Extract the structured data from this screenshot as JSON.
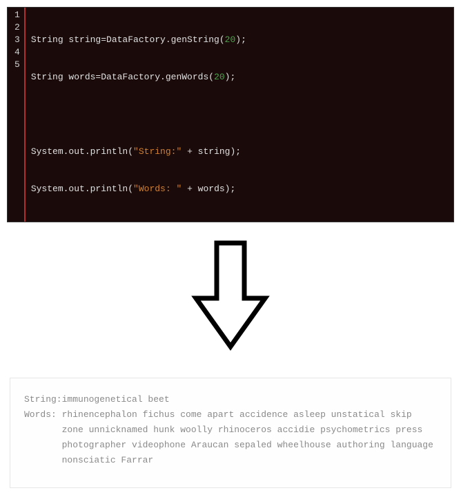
{
  "code": {
    "lines": [
      {
        "num": "1",
        "tokens": [
          {
            "t": "String string=DataFactory.genString(",
            "c": "tok-default"
          },
          {
            "t": "20",
            "c": "tok-num"
          },
          {
            "t": ");",
            "c": "tok-default"
          }
        ]
      },
      {
        "num": "2",
        "tokens": [
          {
            "t": "String words=DataFactory.genWords(",
            "c": "tok-default"
          },
          {
            "t": "20",
            "c": "tok-num"
          },
          {
            "t": ");",
            "c": "tok-default"
          }
        ]
      },
      {
        "num": "3",
        "tokens": []
      },
      {
        "num": "4",
        "tokens": [
          {
            "t": "System.out.println(",
            "c": "tok-default"
          },
          {
            "t": "\"String:\"",
            "c": "tok-string"
          },
          {
            "t": " + string);",
            "c": "tok-default"
          }
        ]
      },
      {
        "num": "5",
        "tokens": [
          {
            "t": "System.out.println(",
            "c": "tok-default"
          },
          {
            "t": "\"Words: \"",
            "c": "tok-string"
          },
          {
            "t": " + words);",
            "c": "tok-default"
          }
        ]
      }
    ]
  },
  "output": {
    "rows": [
      {
        "label": "String:",
        "text": "immunogenetical beet"
      },
      {
        "label": "Words: ",
        "text": "rhinencephalon fichus come apart accidence asleep unstatical skip zone unnicknamed hunk woolly rhinoceros accidie psychometrics press photographer videophone Araucan sepaled wheelhouse authoring language nonsciatic Farrar"
      }
    ]
  }
}
